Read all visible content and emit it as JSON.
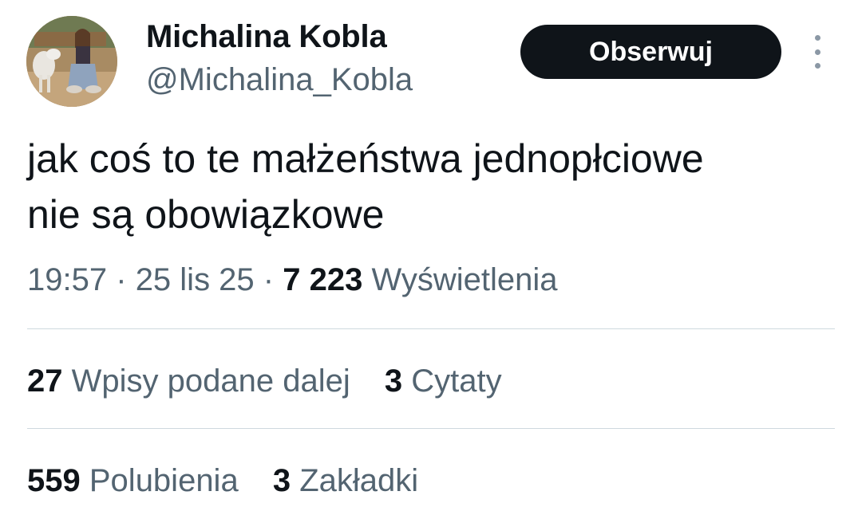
{
  "author": {
    "display_name": "Michalina Kobla",
    "handle": "@Michalina_Kobla",
    "avatar_icon": "profile-photo"
  },
  "follow_button": {
    "label": "Obserwuj"
  },
  "more_icon": "vertical-dots-icon",
  "tweet": {
    "text_line_1": "jak coś to te małżeństwa jednopłciowe",
    "text_line_2": "nie są obowiązkowe"
  },
  "meta": {
    "time": "19:57",
    "separator": "·",
    "date": "25 lis 25",
    "views_count": "7 223",
    "views_label": "Wyświetlenia"
  },
  "stats": {
    "reposts_count": "27",
    "reposts_label": "Wpisy podane dalej",
    "quotes_count": "3",
    "quotes_label": "Cytaty",
    "likes_count": "559",
    "likes_label": "Polubienia",
    "bookmarks_count": "3",
    "bookmarks_label": "Zakładki"
  },
  "colors": {
    "primary_text": "#0f1419",
    "secondary_text": "#536471",
    "divider": "#cfd9de",
    "button_bg": "#0f1419",
    "button_text": "#ffffff"
  }
}
